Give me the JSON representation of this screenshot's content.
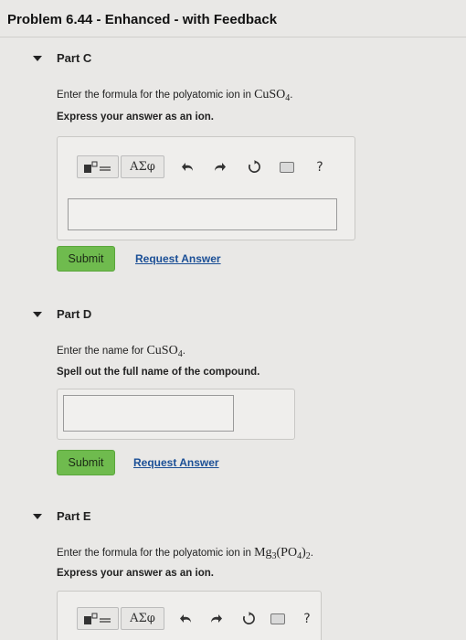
{
  "page_title": "Problem 6.44 - Enhanced - with Feedback",
  "parts": [
    {
      "title": "Part C",
      "prompt_prefix": "Enter the formula for the polyatomic ion in ",
      "formula_main": "CuSO",
      "formula_sub": "4",
      "formula_tail": ".",
      "instruction": "Express your answer as an ion.",
      "submit_label": "Submit",
      "request_label": "Request Answer"
    },
    {
      "title": "Part D",
      "prompt_prefix": "Enter the name for ",
      "formula_main": "CuSO",
      "formula_sub": "4",
      "formula_tail": ".",
      "instruction": "Spell out the full name of the compound.",
      "submit_label": "Submit",
      "request_label": "Request Answer"
    },
    {
      "title": "Part E",
      "prompt_prefix": "Enter the formula for the polyatomic ion in ",
      "formula_main": "Mg",
      "formula_sub": "3",
      "formula_mid": "(PO",
      "formula_sub2": "4",
      "formula_mid2": ")",
      "formula_sub3": "2",
      "formula_tail": ".",
      "instruction": "Express your answer as an ion."
    }
  ],
  "toolbar": {
    "greek_label": "ΑΣφ",
    "help_label": "?",
    "icons": [
      "templates-icon",
      "greek-letters-icon",
      "undo-icon",
      "redo-icon",
      "reset-icon",
      "keyboard-icon",
      "help-icon"
    ]
  }
}
